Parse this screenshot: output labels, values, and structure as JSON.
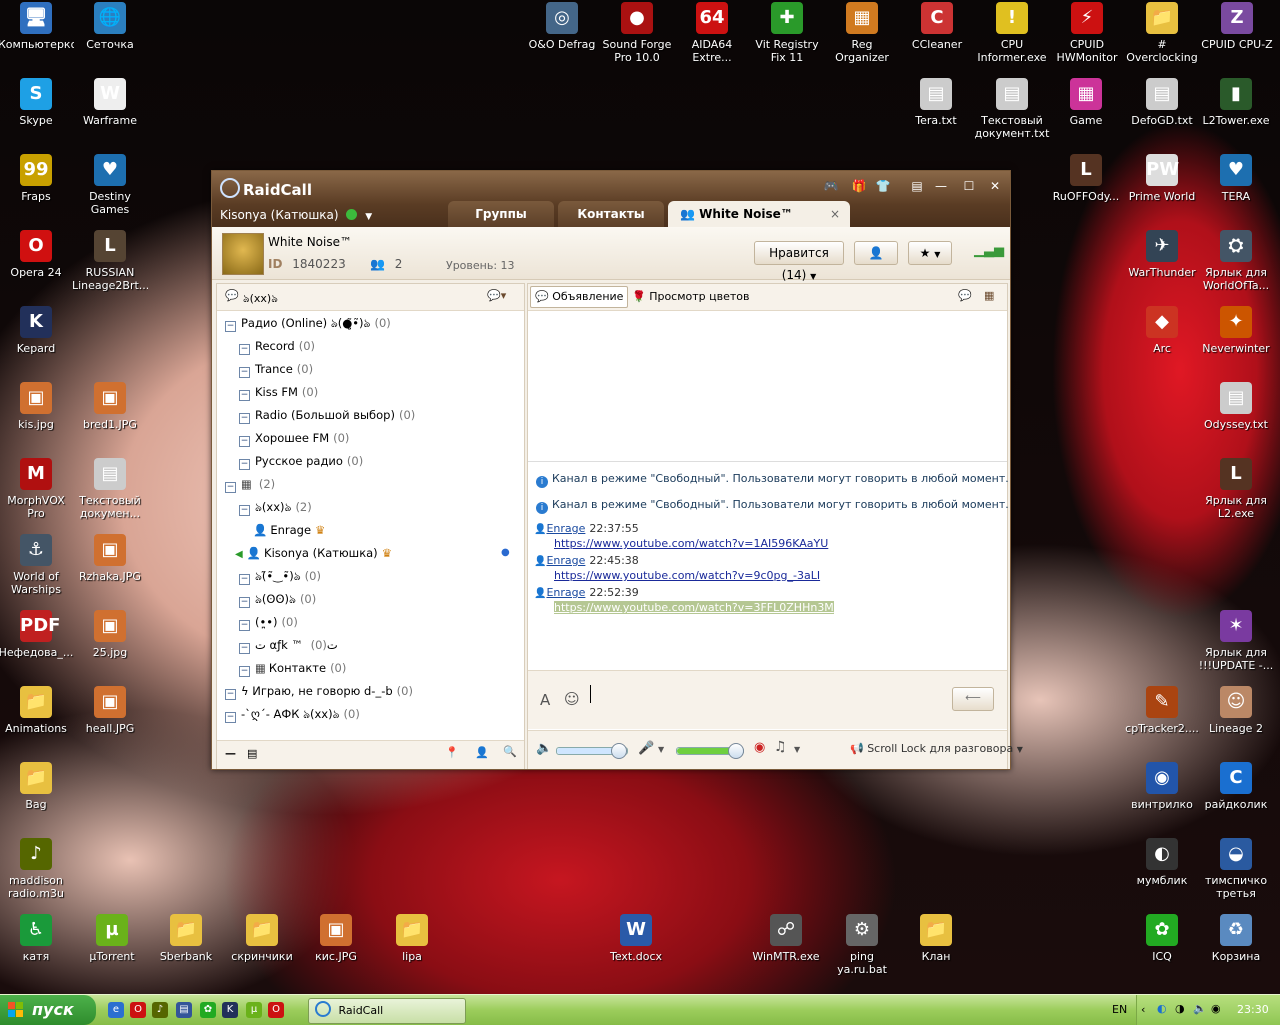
{
  "desktop": {
    "icons_left": [
      {
        "label": "Компьютерко",
        "glyph": "🖥",
        "color": "#2f6fbf"
      },
      {
        "label": "Сеточка",
        "glyph": "🌐",
        "color": "#2b7fbf"
      },
      {
        "label": "Skype",
        "glyph": "S",
        "color": "#1ea0e5"
      },
      {
        "label": "Warframe",
        "glyph": "W",
        "color": "#eeeeee"
      },
      {
        "label": "Fraps",
        "glyph": "99",
        "color": "#c8a000"
      },
      {
        "label": "Destiny Games",
        "glyph": "♥",
        "color": "#1d6fb0"
      },
      {
        "label": "Opera 24",
        "glyph": "O",
        "color": "#d01010"
      },
      {
        "label": "RUSSIAN Lineage2Brt...",
        "glyph": "L",
        "color": "#554433"
      },
      {
        "label": "Kepard",
        "glyph": "K",
        "color": "#22305a"
      },
      {
        "label": "",
        "glyph": "",
        "color": ""
      },
      {
        "label": "kis.jpg",
        "glyph": "▣",
        "color": "#d07030"
      },
      {
        "label": "bred1.JPG",
        "glyph": "▣",
        "color": "#d07030"
      },
      {
        "label": "MorphVOX Pro",
        "glyph": "M",
        "color": "#b01010"
      },
      {
        "label": "Текстовый докумен...",
        "glyph": "▤",
        "color": "#cccccc"
      },
      {
        "label": "World of Warships",
        "glyph": "⚓",
        "color": "#445566"
      },
      {
        "label": "Rzhaka.JPG",
        "glyph": "▣",
        "color": "#d07030"
      },
      {
        "label": "Нефедова_...",
        "glyph": "PDF",
        "color": "#c02020"
      },
      {
        "label": "25.jpg",
        "glyph": "▣",
        "color": "#d07030"
      },
      {
        "label": "Animations",
        "glyph": "📁",
        "color": "#e8c040"
      },
      {
        "label": "heall.JPG",
        "glyph": "▣",
        "color": "#d07030"
      },
      {
        "label": "Bag",
        "glyph": "📁",
        "color": "#e8c040"
      },
      {
        "label": "",
        "glyph": "",
        "color": ""
      },
      {
        "label": "maddison radio.m3u",
        "glyph": "♪",
        "color": "#556600"
      },
      {
        "label": "",
        "glyph": "",
        "color": ""
      }
    ],
    "icons_top": [
      {
        "label": "O&O Defrag",
        "glyph": "◎",
        "color": "#446688"
      },
      {
        "label": "Sound Forge Pro 10.0",
        "glyph": "●",
        "color": "#aa1111"
      },
      {
        "label": "AIDA64 Extre...",
        "glyph": "64",
        "color": "#cc1111"
      },
      {
        "label": "Vit Registry Fix 11",
        "glyph": "✚",
        "color": "#2a9a2a"
      },
      {
        "label": "Reg Organizer",
        "glyph": "▦",
        "color": "#d07a20"
      },
      {
        "label": "CCleaner",
        "glyph": "C",
        "color": "#cc3333"
      },
      {
        "label": "CPU Informer.exe",
        "glyph": "!",
        "color": "#e0c020"
      },
      {
        "label": "CPUID HWMonitor",
        "glyph": "⚡",
        "color": "#cc1111"
      },
      {
        "label": "# Overclocking",
        "glyph": "📁",
        "color": "#e8c040"
      },
      {
        "label": "CPUID CPU-Z",
        "glyph": "Z",
        "color": "#7a4aa0"
      }
    ],
    "icons_right": [
      {
        "label": "Tera.txt",
        "glyph": "▤",
        "color": "#cccccc"
      },
      {
        "label": "Текстовый документ.txt",
        "glyph": "▤",
        "color": "#cccccc"
      },
      {
        "label": "Game",
        "glyph": "▦",
        "color": "#cc3399"
      },
      {
        "label": "DefoGD.txt",
        "glyph": "▤",
        "color": "#cccccc"
      },
      {
        "label": "L2Tower.exe",
        "glyph": "▮",
        "color": "#2a5a2a"
      },
      {
        "label": "RuOFFOdy...",
        "glyph": "L",
        "color": "#553322"
      },
      {
        "label": "Prime World",
        "glyph": "PW",
        "color": "#dddddd"
      },
      {
        "label": "TERA",
        "glyph": "♥",
        "color": "#1d6fb0"
      },
      {
        "label": "WarThunder",
        "glyph": "✈",
        "color": "#334455"
      },
      {
        "label": "Ярлык для WorldOfTa...",
        "glyph": "⛭",
        "color": "#445566"
      },
      {
        "label": "Arc",
        "glyph": "◆",
        "color": "#cc3322"
      },
      {
        "label": "Neverwinter",
        "glyph": "✦",
        "color": "#cc5500"
      },
      {
        "label": "Odyssey.txt",
        "glyph": "▤",
        "color": "#cccccc"
      },
      {
        "label": "Ярлык для L2.exe",
        "glyph": "L",
        "color": "#553322"
      },
      {
        "label": "Ярлык для !!!UPDATE -...",
        "glyph": "✶",
        "color": "#7a3aa0"
      },
      {
        "label": "cpTracker2....",
        "glyph": "✎",
        "color": "#aa4411"
      },
      {
        "label": "Lineage 2",
        "glyph": "☺",
        "color": "#bb8866"
      },
      {
        "label": "винтрилко",
        "glyph": "◉",
        "color": "#2255aa"
      },
      {
        "label": "рaйдколик",
        "glyph": "C",
        "color": "#1a6fd0"
      },
      {
        "label": "мумблик",
        "glyph": "◐",
        "color": "#333333"
      },
      {
        "label": "тимспичко третья",
        "glyph": "◒",
        "color": "#2a5aa0"
      },
      {
        "label": "ICQ",
        "glyph": "✿",
        "color": "#22aa22"
      },
      {
        "label": "Корзина",
        "glyph": "♻",
        "color": "#5a8ac0"
      }
    ],
    "icons_bottom": [
      {
        "label": "катя",
        "glyph": "♿",
        "color": "#1a9a3a"
      },
      {
        "label": "µTorrent",
        "glyph": "µ",
        "color": "#6ab21a"
      },
      {
        "label": "Sberbank",
        "glyph": "📁",
        "color": "#e8c040"
      },
      {
        "label": "скринчики",
        "glyph": "📁",
        "color": "#e8c040"
      },
      {
        "label": "кис.JPG",
        "glyph": "▣",
        "color": "#d07030"
      },
      {
        "label": "lipa",
        "glyph": "📁",
        "color": "#e8c040"
      },
      {
        "label": "Text.docx",
        "glyph": "W",
        "color": "#2a5aa8"
      },
      {
        "label": "WinMTR.exe",
        "glyph": "☍",
        "color": "#555555"
      },
      {
        "label": "ping ya.ru.bat",
        "glyph": "⚙",
        "color": "#666666"
      },
      {
        "label": "Клан",
        "glyph": "📁",
        "color": "#e8c040"
      }
    ]
  },
  "window": {
    "title": "RaidCall",
    "user_status": "Kisonya (Катюшка)",
    "tabs": [
      {
        "label": "Группы"
      },
      {
        "label": "Контакты"
      },
      {
        "label": "White Noise™"
      }
    ],
    "tab_close": "×",
    "channel": {
      "name": "White Noise™",
      "id_label": "ID",
      "id": "1840223",
      "members": "2",
      "level": "Уровень: 13",
      "like_btn": "Нравится (14)"
    },
    "left_header": "ঌ(xx)ঌ",
    "tree": [
      {
        "indent": 0,
        "label": "Радио (Online) ঌ(●̮̮̃•̃)ঌ",
        "count": "(0)"
      },
      {
        "indent": 1,
        "label": "Record",
        "count": "(0)"
      },
      {
        "indent": 1,
        "label": "Trance",
        "count": "(0)"
      },
      {
        "indent": 1,
        "label": "Kiss FM",
        "count": "(0)"
      },
      {
        "indent": 1,
        "label": "Radio (Большой выбор)",
        "count": "(0)"
      },
      {
        "indent": 1,
        "label": "Хорошее FM",
        "count": "(0)"
      },
      {
        "indent": 1,
        "label": "Русское радио",
        "count": "(0)"
      },
      {
        "indent": 0,
        "label": "",
        "count": "(2)",
        "badge": "true"
      },
      {
        "indent": 1,
        "label": "ঌ(xx)ঌ",
        "count": "(2)"
      },
      {
        "indent": 2,
        "label": "Enrage",
        "count": "",
        "user": "true",
        "mod": "true"
      },
      {
        "indent": 2,
        "label": "Kisonya (Катюшка)",
        "count": "",
        "user": "true",
        "mod": "true",
        "speaking": "true"
      },
      {
        "indent": 1,
        "label": "ঌ(̃•̃‿•̃)ঌ",
        "count": "(0)"
      },
      {
        "indent": 1,
        "label": "ঌ(ʘʘ)ঌ",
        "count": "(0)"
      },
      {
        "indent": 1,
        "label": "(•̪•)",
        "count": "(0)"
      },
      {
        "indent": 1,
        "label": "ت αƒk ™ ت",
        "count": "(0)"
      },
      {
        "indent": 1,
        "label": "Контакте",
        "count": "(0)",
        "badge": "true"
      },
      {
        "indent": 0,
        "label": "ϟ Играю, не говорю d-_-b",
        "count": "(0)"
      },
      {
        "indent": 0,
        "label": "-`ღ´- АФК ঌ(xx)ঌ",
        "count": "(0)"
      }
    ],
    "right_toolbar": {
      "announce": "Объявление",
      "flowers": "Просмотр цветов"
    },
    "chat": {
      "system": [
        "Канал в режиме \"Свободный\". Пользователи могут говорить в любой момент.",
        "Канал в режиме \"Свободный\". Пользователи могут говорить в любой момент."
      ],
      "messages": [
        {
          "name": "Enrage",
          "time": "22:37:55",
          "link": "https://www.youtube.com/watch?v=1AI596KAaYU"
        },
        {
          "name": "Enrage",
          "time": "22:45:38",
          "link": "https://www.youtube.com/watch?v=9c0pg_-3aLI"
        },
        {
          "name": "Enrage",
          "time": "22:52:39",
          "link": "https://www.youtube.com/watch?v=3FFL0ZHHn3M"
        }
      ]
    },
    "voice": {
      "mode": "Scroll Lock для разговора",
      "speaker_level": 0.85,
      "mic_level": 0.85
    }
  },
  "taskbar": {
    "start": "пуск",
    "task": "RaidCall",
    "lang": "EN",
    "clock": "23:30"
  },
  "colors": {
    "accent": "#6b4a2e",
    "link": "#1a2a9a",
    "highlight": "#b5c793"
  }
}
